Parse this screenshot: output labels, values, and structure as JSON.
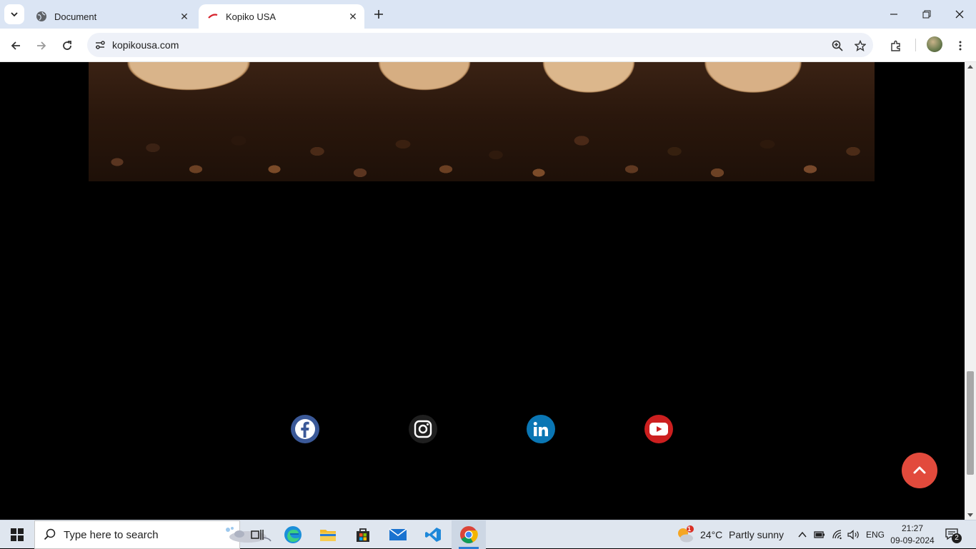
{
  "browser": {
    "tabs": [
      {
        "title": "Document",
        "active": false,
        "favicon": "globe-icon"
      },
      {
        "title": "Kopiko USA",
        "active": true,
        "favicon": "kopiko-logo-icon"
      }
    ],
    "address": "kopikousa.com"
  },
  "page": {
    "image": "coffee-beans-with-wooden-scoops",
    "social_links": [
      {
        "name": "facebook",
        "icon": "facebook-icon",
        "color": "#3b5998"
      },
      {
        "name": "instagram",
        "icon": "instagram-icon",
        "color": "#1f1f1f"
      },
      {
        "name": "linkedin",
        "icon": "linkedin-icon",
        "color": "#0a76b4"
      },
      {
        "name": "youtube",
        "icon": "youtube-icon",
        "color": "#cc1f1f"
      }
    ],
    "back_to_top_color": "#e24a3c"
  },
  "taskbar": {
    "search_placeholder": "Type here to search",
    "weather": {
      "temp": "24°C",
      "condition": "Partly sunny",
      "alert_count": "1"
    },
    "language": "ENG",
    "time": "21:27",
    "date": "09-09-2024",
    "notifications": "2"
  }
}
